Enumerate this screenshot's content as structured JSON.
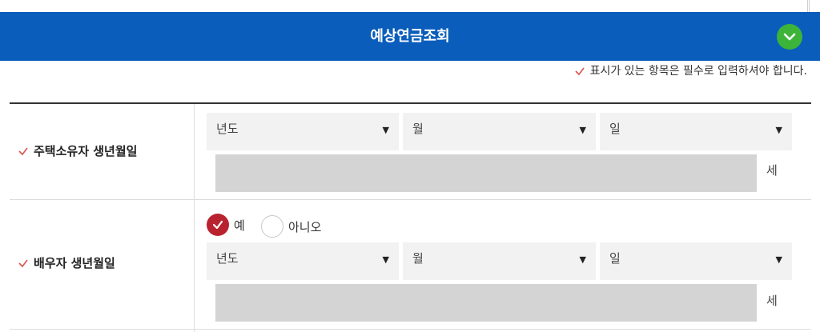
{
  "header": {
    "title": "예상연금조회",
    "toggle_icon": "chevron-down-icon",
    "toggle_color": "#3cb43a",
    "background": "#0a5dbb"
  },
  "notice": {
    "text": "표시가 있는 항목은 필수로 입력하셔야 합니다.",
    "icon": "check-icon",
    "icon_color": "#d9534f"
  },
  "form": {
    "owner": {
      "label": "주택소유자 생년월일",
      "year_placeholder": "년도",
      "month_placeholder": "월",
      "day_placeholder": "일",
      "age_unit": "세",
      "age_value": ""
    },
    "spouse": {
      "label": "배우자 생년월일",
      "radio_yes": "예",
      "radio_no": "아니오",
      "selected": "예",
      "year_placeholder": "년도",
      "month_placeholder": "월",
      "day_placeholder": "일",
      "age_unit": "세",
      "age_value": ""
    }
  },
  "caret": "▼"
}
